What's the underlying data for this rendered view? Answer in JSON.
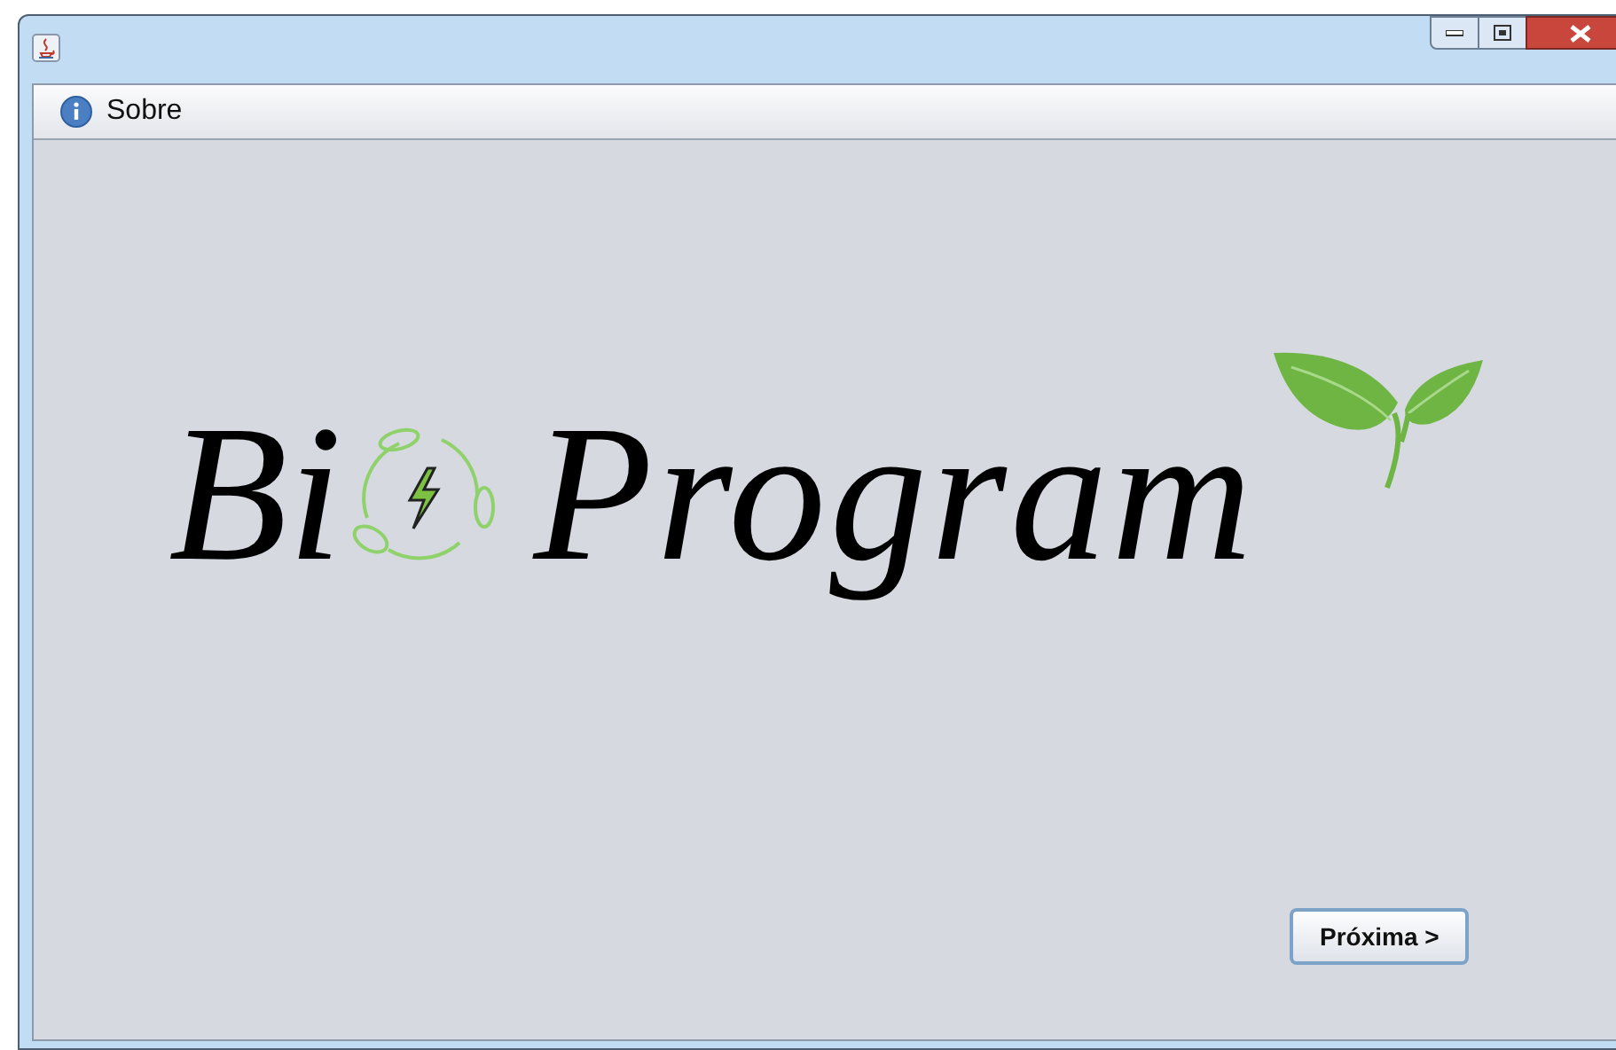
{
  "menu": [
    {
      "label": "Sobre"
    }
  ],
  "logo": {
    "first_word": "Bi",
    "second_word": "Program"
  },
  "next_button": {
    "label": "Próxima >"
  }
}
